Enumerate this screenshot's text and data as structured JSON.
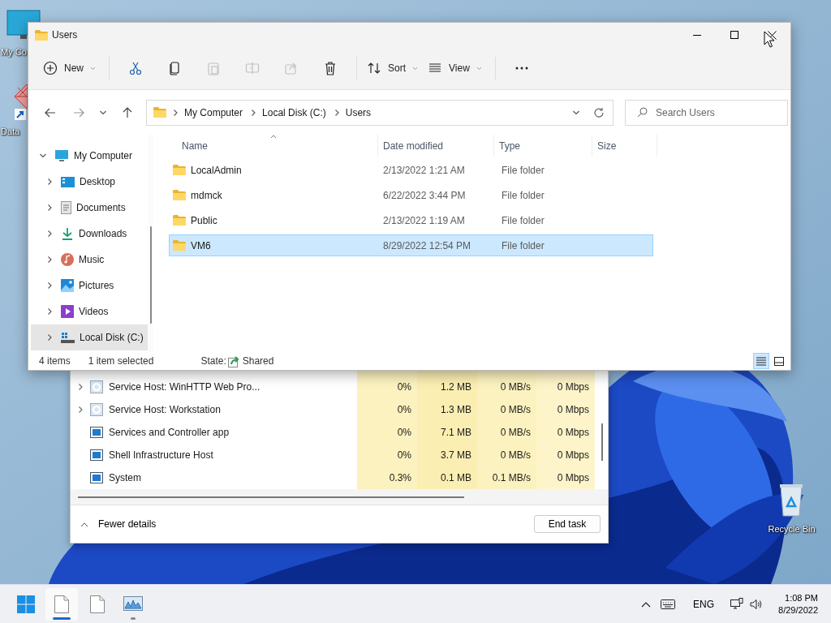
{
  "desktop": {
    "icons": [
      {
        "kind": "computer",
        "label": "My Co"
      },
      {
        "kind": "app",
        "label": "Data"
      },
      {
        "kind": "recycle-bin",
        "label": "Recycle Bin"
      }
    ]
  },
  "explorer": {
    "title": "Users",
    "toolbar": [
      {
        "kind": "new",
        "label": "New",
        "disabled": false
      },
      {
        "kind": "cut",
        "disabled": false
      },
      {
        "kind": "copy",
        "disabled": false
      },
      {
        "kind": "paste",
        "disabled": true
      },
      {
        "kind": "rename",
        "disabled": true
      },
      {
        "kind": "share",
        "disabled": true
      },
      {
        "kind": "delete",
        "disabled": false
      },
      {
        "kind": "sort",
        "label": "Sort",
        "disabled": false
      },
      {
        "kind": "view",
        "label": "View",
        "disabled": false
      },
      {
        "kind": "more",
        "disabled": false
      }
    ],
    "address": {
      "crumbs": [
        "My Computer",
        "Local Disk (C:)",
        "Users"
      ]
    },
    "search": {
      "placeholder": "Search Users"
    },
    "navigation": [
      {
        "kind": "computer",
        "label": "My Computer",
        "expanded": true,
        "selected": false,
        "children": [
          {
            "kind": "desktop",
            "label": "Desktop",
            "expanded": false,
            "selected": false
          },
          {
            "kind": "documents",
            "label": "Documents",
            "expanded": false,
            "selected": false
          },
          {
            "kind": "downloads",
            "label": "Downloads",
            "expanded": false,
            "selected": false
          },
          {
            "kind": "music",
            "label": "Music",
            "expanded": false,
            "selected": false
          },
          {
            "kind": "pictures",
            "label": "Pictures",
            "expanded": false,
            "selected": false
          },
          {
            "kind": "videos",
            "label": "Videos",
            "expanded": false,
            "selected": false
          },
          {
            "kind": "drive",
            "label": "Local Disk (C:)",
            "expanded": false,
            "selected": true
          }
        ]
      }
    ],
    "columns": [
      {
        "label": "Name",
        "sorted": true
      },
      {
        "label": "Date modified",
        "sorted": false
      },
      {
        "label": "Type",
        "sorted": false
      },
      {
        "label": "Size",
        "sorted": false
      }
    ],
    "rows": [
      {
        "name": "LocalAdmin",
        "date_modified": "2/13/2022 1:21 AM",
        "type": "File folder",
        "selected": false
      },
      {
        "name": "mdmck",
        "date_modified": "6/22/2022 3:44 PM",
        "type": "File folder",
        "selected": false
      },
      {
        "name": "Public",
        "date_modified": "2/13/2022 1:19 AM",
        "type": "File folder",
        "selected": false
      },
      {
        "name": "VM6",
        "date_modified": "8/29/2022 12:54 PM",
        "type": "File folder",
        "selected": true
      }
    ],
    "status": {
      "item_count": "4 items",
      "selection": "1 item selected",
      "state_label": "State:",
      "state_value": "Shared"
    },
    "views": [
      {
        "kind": "details",
        "selected": true
      },
      {
        "kind": "tiles",
        "selected": false
      }
    ]
  },
  "task_manager": {
    "processes": [
      {
        "kind": "service",
        "name": "Service Host: WinHTTP Web Pro...",
        "expandable": true,
        "cpu": "0%",
        "memory": "1.2 MB",
        "disk": "0 MB/s",
        "network": "0 Mbps"
      },
      {
        "kind": "service",
        "name": "Service Host: Workstation",
        "expandable": true,
        "cpu": "0%",
        "memory": "1.3 MB",
        "disk": "0 MB/s",
        "network": "0 Mbps"
      },
      {
        "kind": "app",
        "name": "Services and Controller app",
        "expandable": false,
        "cpu": "0%",
        "memory": "7.1 MB",
        "disk": "0 MB/s",
        "network": "0 Mbps"
      },
      {
        "kind": "app",
        "name": "Shell Infrastructure Host",
        "expandable": false,
        "cpu": "0%",
        "memory": "3.7 MB",
        "disk": "0 MB/s",
        "network": "0 Mbps"
      },
      {
        "kind": "app",
        "name": "System",
        "expandable": false,
        "cpu": "0.3%",
        "memory": "0.1 MB",
        "disk": "0.1 MB/s",
        "network": "0 Mbps"
      }
    ],
    "fewer_details": "Fewer details",
    "end_task": "End task"
  },
  "taskbar": {
    "apps": [
      {
        "kind": "document",
        "active": true,
        "running": true
      },
      {
        "kind": "document",
        "active": false,
        "running": false
      },
      {
        "kind": "monitor",
        "active": false,
        "running": true
      }
    ],
    "language": "ENG",
    "time": "1:08 PM",
    "date": "8/29/2022"
  }
}
